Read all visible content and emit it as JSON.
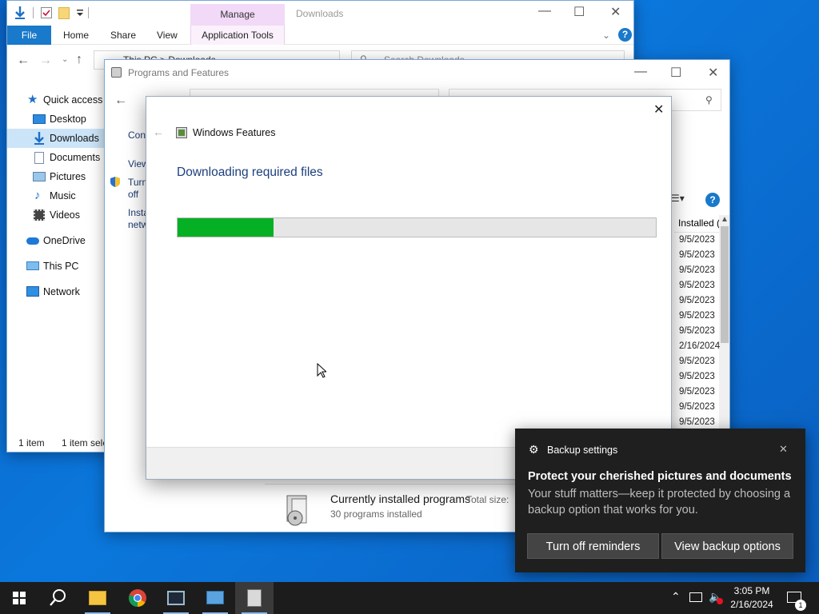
{
  "explorer": {
    "title": "Downloads",
    "tabs": {
      "file": "File",
      "home": "Home",
      "share": "Share",
      "view": "View",
      "manage": "Manage",
      "app_tools": "Application Tools"
    },
    "address": "This PC  >  Downloads",
    "search_placeholder": "Search Downloads",
    "nav_items": [
      {
        "label": "Quick access",
        "icon": "star-icon"
      },
      {
        "label": "Desktop",
        "icon": "desktop-icon"
      },
      {
        "label": "Downloads",
        "icon": "download-arrow-icon"
      },
      {
        "label": "Documents",
        "icon": "document-icon"
      },
      {
        "label": "Pictures",
        "icon": "pictures-icon"
      },
      {
        "label": "Music",
        "icon": "music-icon"
      },
      {
        "label": "Videos",
        "icon": "videos-icon"
      },
      {
        "label": "OneDrive",
        "icon": "cloud-icon"
      },
      {
        "label": "This PC",
        "icon": "computer-icon"
      },
      {
        "label": "Network",
        "icon": "network-icon"
      }
    ],
    "status_items": "1 item",
    "status_selected": "1 item sele"
  },
  "programs_features": {
    "title": "Programs and Features",
    "side_links": [
      "Cont",
      "View",
      "Turn",
      "off",
      "Insta",
      "netw"
    ],
    "column_header": "Installed (",
    "installed_dates": [
      "9/5/2023",
      "9/5/2023",
      "9/5/2023",
      "9/5/2023",
      "9/5/2023",
      "9/5/2023",
      "9/5/2023",
      "2/16/2024",
      "9/5/2023",
      "9/5/2023",
      "9/5/2023",
      "9/5/2023",
      "9/5/2023"
    ],
    "summary_title": "Currently installed programs",
    "summary_size_label": "Total size:",
    "summary_count": "30 programs installed"
  },
  "windows_features": {
    "title": "Windows Features",
    "heading": "Downloading required files",
    "progress": 0.2
  },
  "toast": {
    "app": "Backup settings",
    "title": "Protect your cherished pictures and documents",
    "body": "Your stuff matters—keep it protected by choosing a backup option that works for you.",
    "btn_off": "Turn off reminders",
    "btn_view": "View backup options"
  },
  "taskbar": {
    "time": "3:05 PM",
    "date": "2/16/2024",
    "notification_count": "1",
    "apps": [
      "start-icon",
      "search-icon",
      "file-explorer-icon",
      "chrome-icon",
      "media-app-icon",
      "control-panel-icon",
      "programs-features-icon"
    ]
  },
  "colors": {
    "accent": "#1979ca",
    "progress": "#06b025",
    "desktop": "#0b6fd4",
    "toast_bg": "#1f1f1f"
  }
}
